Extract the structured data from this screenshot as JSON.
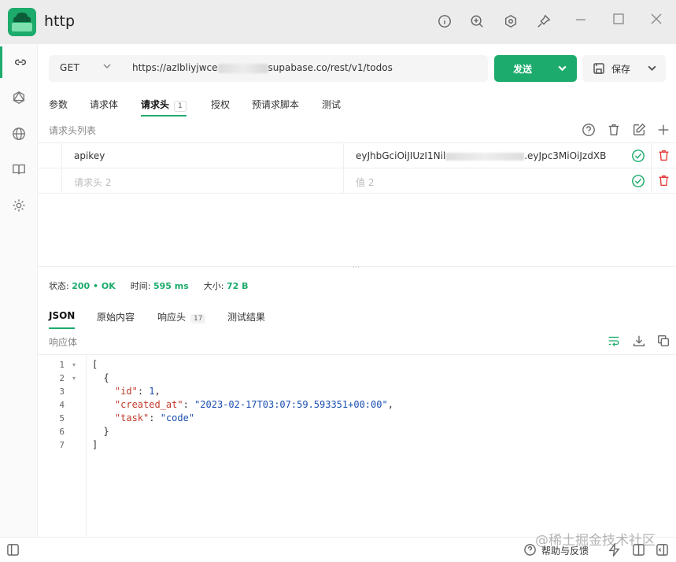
{
  "window": {
    "title": "http",
    "toolbar_icons": [
      "info-icon",
      "zoom-in-icon",
      "hexagon-icon",
      "pin-icon"
    ],
    "controls": [
      "minimize",
      "maximize",
      "close"
    ]
  },
  "sidebar": {
    "items": [
      {
        "icon": "link-icon",
        "active": true
      },
      {
        "icon": "graphql-icon",
        "active": false
      },
      {
        "icon": "globe-icon",
        "active": false
      },
      {
        "icon": "book-icon",
        "active": false
      },
      {
        "icon": "gear-icon",
        "active": false
      }
    ]
  },
  "request": {
    "method": "GET",
    "url_prefix": "https://azlbliyjwce",
    "url_suffix": "supabase.co/rest/v1/todos",
    "send_label": "发送",
    "save_label": "保存"
  },
  "request_tabs": {
    "params": "参数",
    "body": "请求体",
    "headers": "请求头",
    "headers_count": "1",
    "auth": "授权",
    "prescript": "预请求脚本",
    "tests": "测试"
  },
  "headers_section": {
    "label": "请求头列表",
    "rows": [
      {
        "key": "apikey",
        "value_prefix": "eyJhbGciOiJIUzI1Nil",
        "value_suffix": ".eyJpc3MiOiJzdXB"
      },
      {
        "key_placeholder": "请求头 2",
        "value_placeholder": "值 2"
      }
    ]
  },
  "status": {
    "status_label": "状态:",
    "status_value": "200 • OK",
    "time_label": "时间:",
    "time_value": "595 ms",
    "size_label": "大小:",
    "size_value": "72 B"
  },
  "response_tabs": {
    "json": "JSON",
    "raw": "原始内容",
    "headers": "响应头",
    "headers_count": "17",
    "tests": "测试结果"
  },
  "response_body": {
    "label": "响应体",
    "line_numbers": [
      "1",
      "2",
      "3",
      "4",
      "5",
      "6",
      "7"
    ],
    "lines": {
      "l1": "[",
      "l2": "  {",
      "l3_key": "\"id\"",
      "l3_val": "1",
      "l4_key": "\"created_at\"",
      "l4_val": "\"2023-02-17T03:07:59.593351+00:00\"",
      "l5_key": "\"task\"",
      "l5_val": "\"code\"",
      "l6": "  }",
      "l7": "]"
    }
  },
  "footer": {
    "help_label": "帮助与反馈",
    "watermark": "@稀土掘金技术社区"
  },
  "colors": {
    "accent": "#1cab6c",
    "danger": "#e53935",
    "titlebar": "#ececec"
  }
}
